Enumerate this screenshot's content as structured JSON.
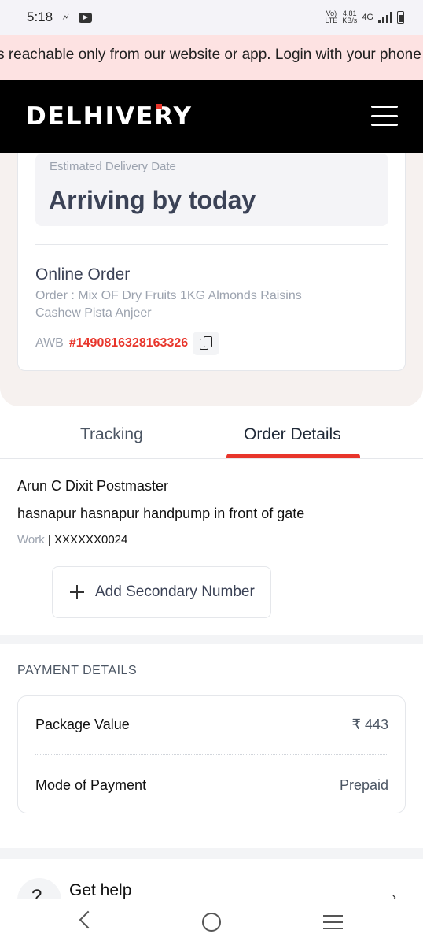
{
  "status_bar": {
    "time": "5:18",
    "network_top": "Vo)",
    "network_bottom": "LTE",
    "speed_top": "4.81",
    "speed_bottom": "KB/s",
    "network_type": "4G",
    "icons": [
      "flash-icon",
      "youtube-icon",
      "signal-icon",
      "battery-icon"
    ]
  },
  "banner": {
    "text": "n is reachable only from our website or app. Login with your phone"
  },
  "header": {
    "logo": "DELHIVERY",
    "menu_icon": "hamburger-menu-icon"
  },
  "delivery": {
    "eta_label": "Estimated Delivery Date",
    "eta_value": "Arriving by today"
  },
  "order": {
    "title": "Online Order",
    "description": "Order : Mix OF Dry Fruits 1KG Almonds Raisins Cashew Pista Anjeer",
    "awb_label": "AWB",
    "awb_number": "#1490816328163326",
    "copy_icon": "copy-icon"
  },
  "tabs": [
    {
      "label": "Tracking",
      "active": false
    },
    {
      "label": "Order Details",
      "active": true
    }
  ],
  "address": {
    "name": "Arun C Dixit Postmaster",
    "line": "hasnapur hasnapur handpump in front of gate",
    "phone_type": "Work",
    "phone_separator": " | ",
    "phone": "XXXXXX0024"
  },
  "add_secondary": {
    "label": "Add Secondary Number"
  },
  "payment": {
    "title": "PAYMENT DETAILS",
    "rows": [
      {
        "label": "Package Value",
        "value": "₹ 443"
      },
      {
        "label": "Mode of Payment",
        "value": "Prepaid"
      }
    ]
  },
  "help": {
    "label": "Get help",
    "icon": "help-icon"
  },
  "colors": {
    "accent": "#e8352b",
    "header_bg": "#000000",
    "banner_bg": "#fde2e2",
    "section_bg": "#f6f1ef"
  }
}
